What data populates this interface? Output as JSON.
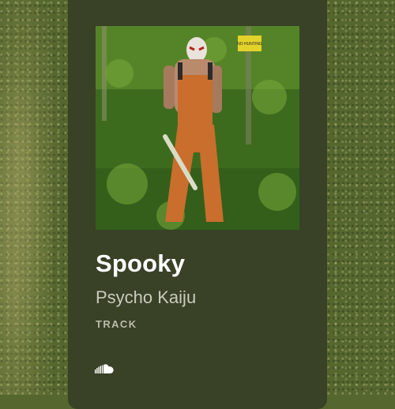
{
  "track": {
    "title": "Spooky",
    "artist": "Psycho Kaiju",
    "kind_label": "TRACK"
  },
  "artwork": {
    "sign_text": "NO HUNTING"
  },
  "icons": {
    "provider": "soundcloud-icon"
  },
  "colors": {
    "background": "#55672e",
    "card": "#394127",
    "title": "#ffffff",
    "artist": "#c7ccbd",
    "label": "#b8bdaa"
  }
}
